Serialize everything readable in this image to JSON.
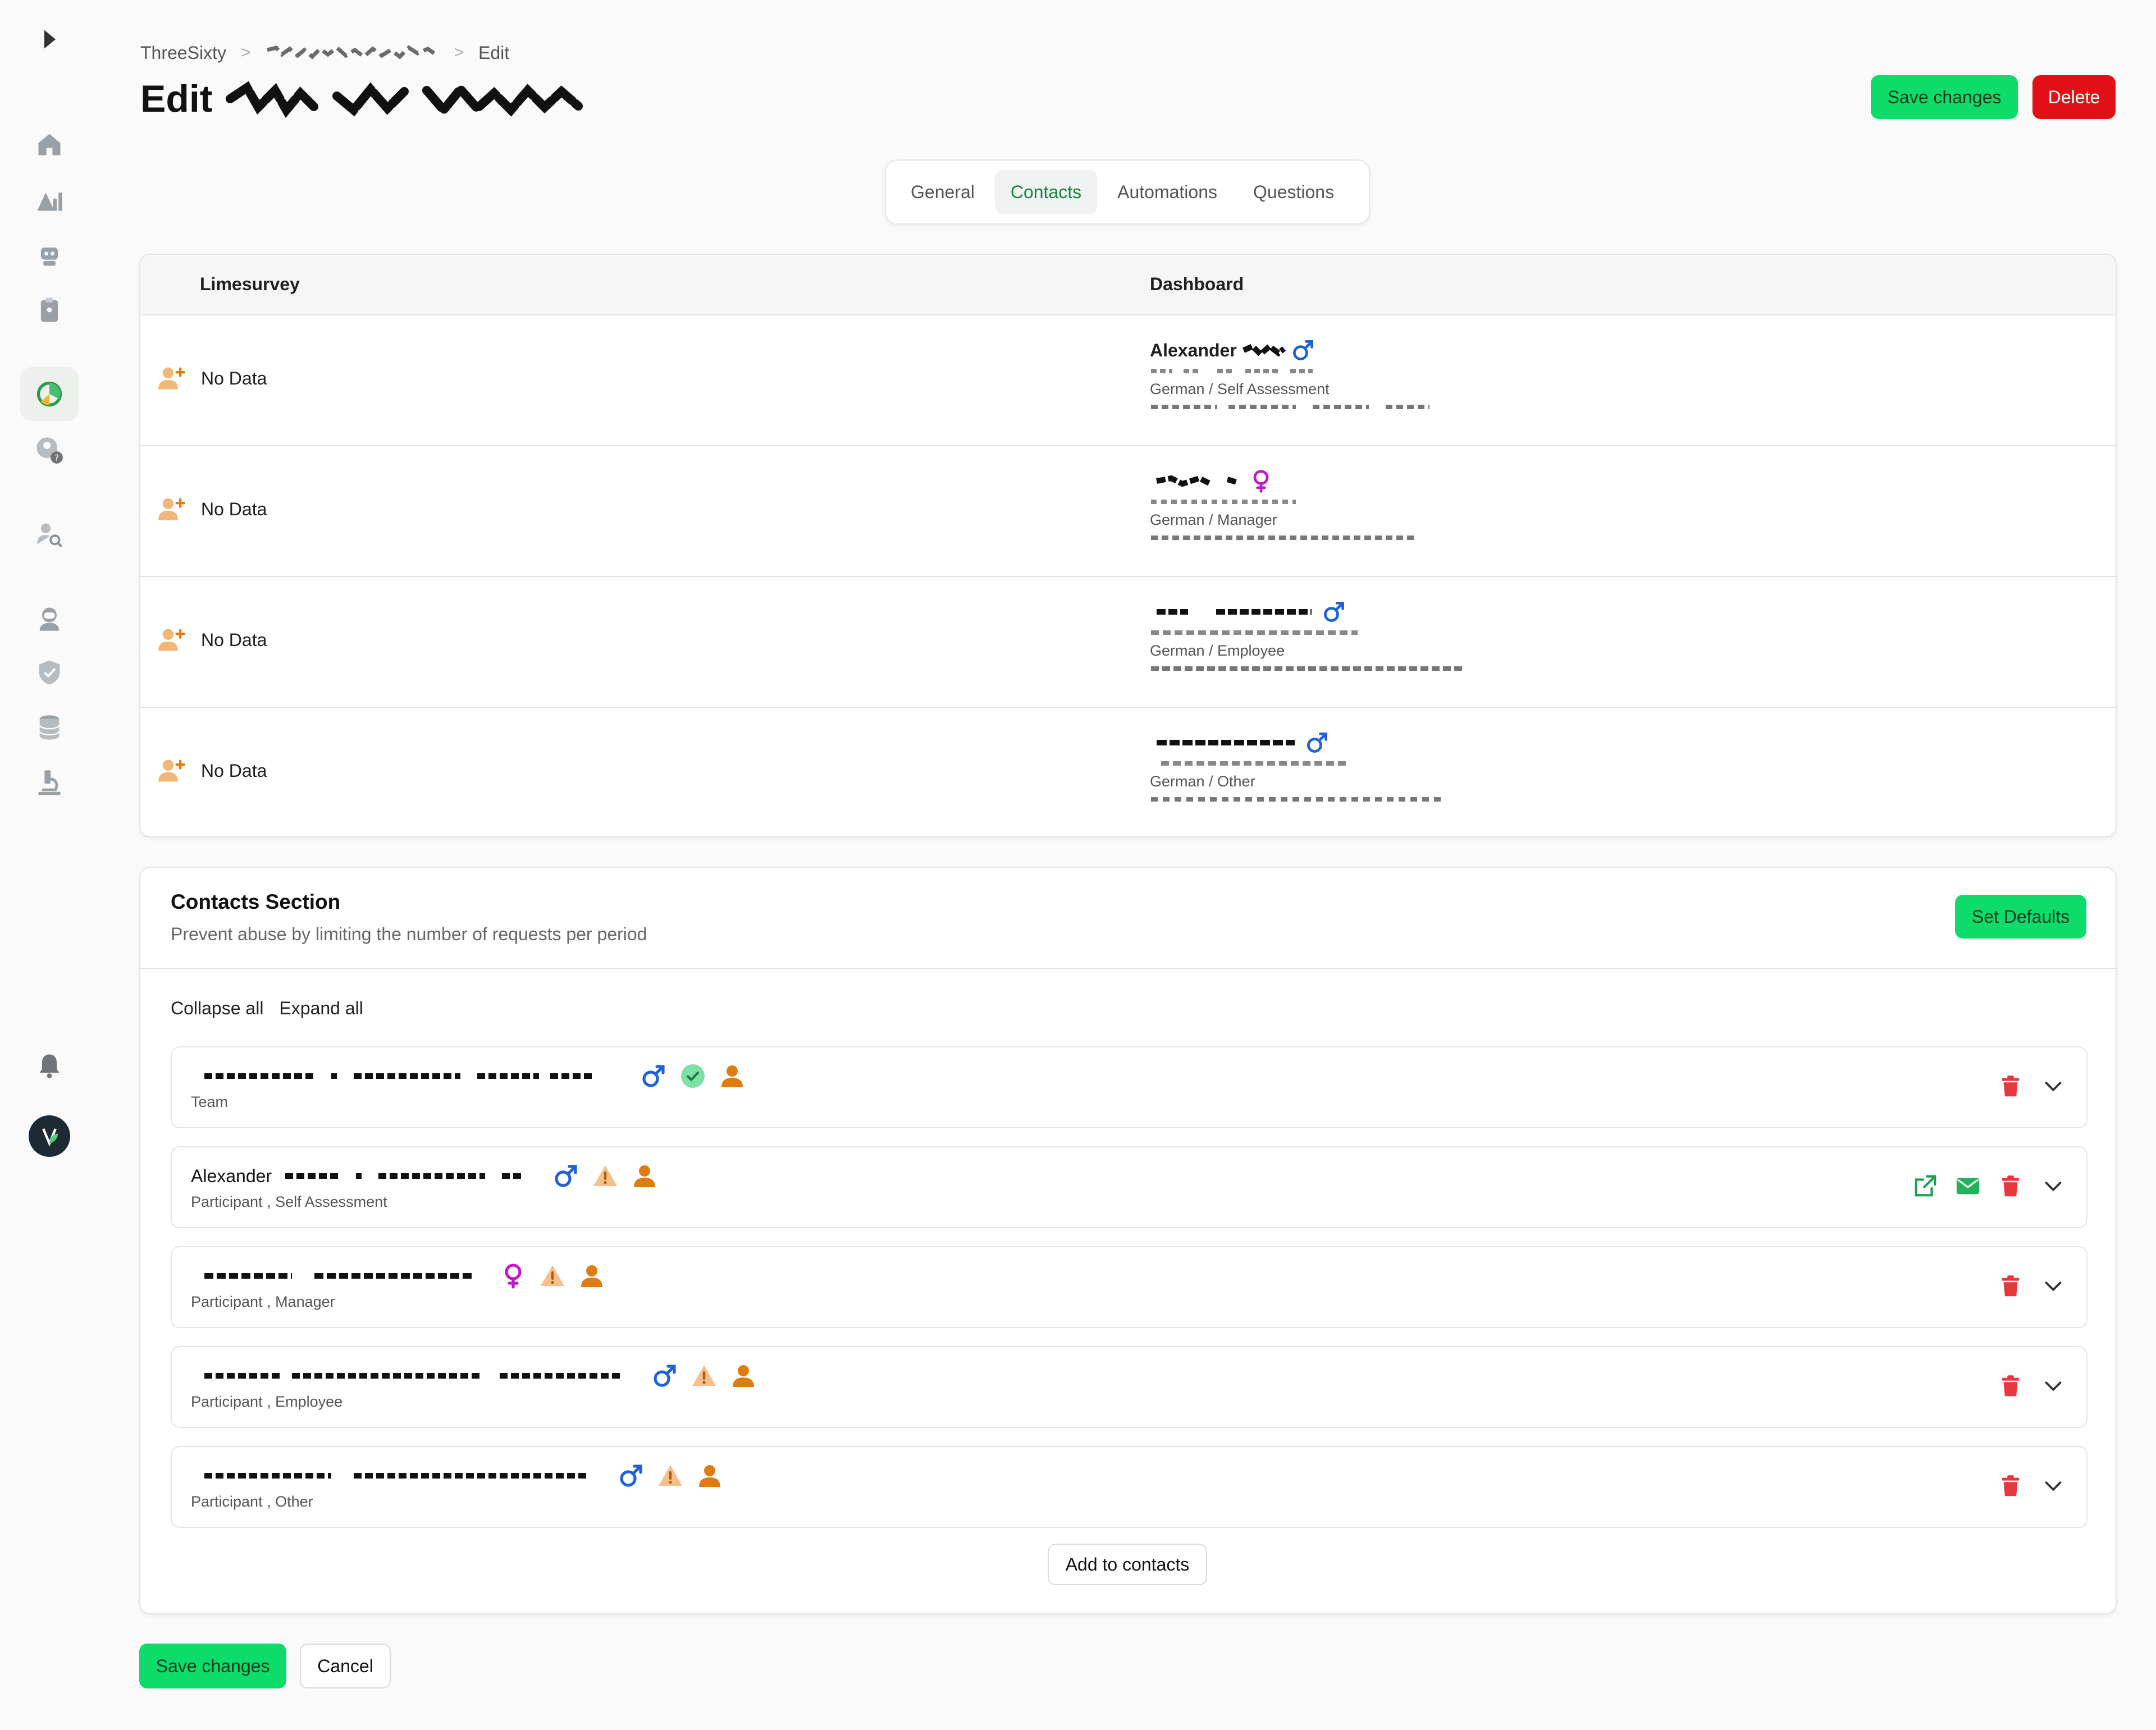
{
  "breadcrumb": {
    "root": "ThreeSixty",
    "current": "Edit"
  },
  "title": {
    "prefix": "Edit"
  },
  "actions": {
    "save_label": "Save changes",
    "delete_label": "Delete"
  },
  "tabs": [
    {
      "label": "General"
    },
    {
      "label": "Contacts"
    },
    {
      "label": "Automations"
    },
    {
      "label": "Questions"
    }
  ],
  "active_tab": "Contacts",
  "mapping": {
    "col_left": "Limesurvey",
    "col_right": "Dashboard",
    "rows": [
      {
        "left": "No Data",
        "name": "Alexander",
        "gender_icon": "male-icon",
        "lang_role": "German / Self Assessment"
      },
      {
        "left": "No Data",
        "name": "",
        "gender_icon": "female-icon",
        "lang_role": "German / Manager"
      },
      {
        "left": "No Data",
        "name": "",
        "gender_icon": "male-icon",
        "lang_role": "German / Employee"
      },
      {
        "left": "No Data",
        "name": "",
        "gender_icon": "male-icon",
        "lang_role": "German / Other"
      }
    ]
  },
  "contacts_section": {
    "title": "Contacts Section",
    "subtitle": "Prevent abuse by limiting the number of requests per period",
    "set_defaults_label": "Set Defaults",
    "collapse_all": "Collapse all",
    "expand_all": "Expand all",
    "add_label": "Add to contacts",
    "items": [
      {
        "name": "",
        "subtitle": "Team",
        "gender_icon": "male-icon",
        "status_icon": "check-circle-icon"
      },
      {
        "name": "Alexander",
        "subtitle": "Participant , Self Assessment",
        "gender_icon": "male-icon",
        "status_icon": "warning-icon"
      },
      {
        "name": "",
        "subtitle": "Participant , Manager",
        "gender_icon": "female-icon",
        "status_icon": "warning-icon"
      },
      {
        "name": "",
        "subtitle": "Participant , Employee",
        "gender_icon": "male-icon",
        "status_icon": "warning-icon"
      },
      {
        "name": "",
        "subtitle": "Participant , Other",
        "gender_icon": "male-icon",
        "status_icon": "warning-icon"
      }
    ]
  },
  "footer": {
    "save_label": "Save changes",
    "cancel_label": "Cancel"
  },
  "colors": {
    "accent_green": "#0ddc6a",
    "danger_red": "#e30f16",
    "male_blue": "#1e63d6",
    "female_magenta": "#c218c9",
    "person_orange": "#e07b10"
  }
}
